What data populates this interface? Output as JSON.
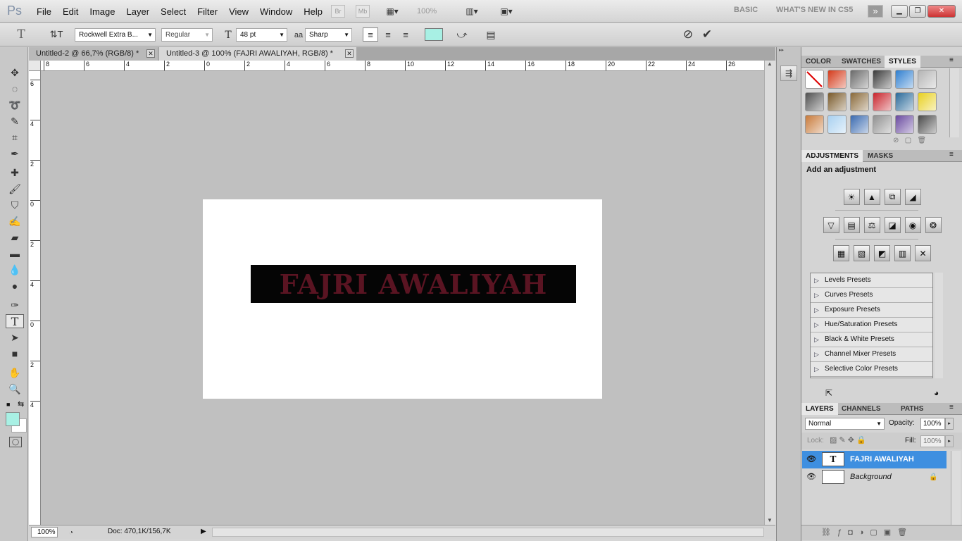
{
  "app": {
    "logo": "Ps"
  },
  "menu": [
    "File",
    "Edit",
    "Image",
    "Layer",
    "Select",
    "Filter",
    "View",
    "Window",
    "Help"
  ],
  "appbar": {
    "br": "Br",
    "mb": "Mb",
    "zoom": "100%",
    "workspace_basic": "BASIC",
    "workspace_new": "WHAT'S NEW IN CS5",
    "more": "»"
  },
  "window_buttons": {
    "minimize": "▁",
    "restore": "❐",
    "close": "✕"
  },
  "options": {
    "font_family": "Rockwell Extra B...",
    "font_style": "Regular",
    "font_size": "48 pt",
    "antialias": "Sharp",
    "aa_label": "a",
    "text_color": "#a8f0e4"
  },
  "tabs": [
    {
      "label": "Untitled-2 @ 66,7% (RGB/8) *"
    },
    {
      "label": "Untitled-3 @ 100% (FAJRI AWALIYAH, RGB/8) *"
    }
  ],
  "ruler_top": [
    "8",
    "6",
    "4",
    "2",
    "0",
    "2",
    "4",
    "6",
    "8",
    "10",
    "12",
    "14",
    "16",
    "18",
    "20",
    "22",
    "24",
    "26"
  ],
  "ruler_left": [
    "6",
    "4",
    "2",
    "0",
    "2",
    "4",
    "0",
    "2",
    "4"
  ],
  "canvas_text": "FAJRI AWALIYAH",
  "status": {
    "zoom": "100%",
    "doc": "Doc: 470,1K/156,7K"
  },
  "styles_panel": {
    "tabs": [
      "COLOR",
      "SWATCHES",
      "STYLES"
    ],
    "swatch_colors": [
      "#ffffff",
      "#d43a1a",
      "#6a6a6a",
      "#3a3a3a",
      "#2f7fd0",
      "#b4b4b4",
      "#505050",
      "#7a5a2a",
      "#8a6a3a",
      "#c8242c",
      "#2a6a9a",
      "#e8d020",
      "#c87a3a",
      "#a8d0f0",
      "#3a6ab0",
      "#909090",
      "#6a4aa0",
      "#4a4a4a"
    ]
  },
  "adjustments_panel": {
    "tabs": [
      "ADJUSTMENTS",
      "MASKS"
    ],
    "heading": "Add an adjustment",
    "row1": [
      "☀",
      "▲",
      "⧉",
      "◢"
    ],
    "row2": [
      "▽",
      "▤",
      "⚖",
      "◪",
      "◉",
      "❂"
    ],
    "row3": [
      "▦",
      "▧",
      "◩",
      "▥",
      "✕"
    ],
    "presets": [
      "Levels Presets",
      "Curves Presets",
      "Exposure Presets",
      "Hue/Saturation Presets",
      "Black & White Presets",
      "Channel Mixer Presets",
      "Selective Color Presets"
    ]
  },
  "layers_panel": {
    "tabs": [
      "LAYERS",
      "CHANNELS",
      "PATHS"
    ],
    "blend_mode": "Normal",
    "opacity_label": "Opacity:",
    "opacity": "100%",
    "lock_label": "Lock:",
    "fill_label": "Fill:",
    "fill": "100%",
    "layers": [
      {
        "name": "FAJRI AWALIYAH",
        "thumb": "T",
        "selected": true
      },
      {
        "name": "Background",
        "thumb": "",
        "selected": false
      }
    ]
  }
}
